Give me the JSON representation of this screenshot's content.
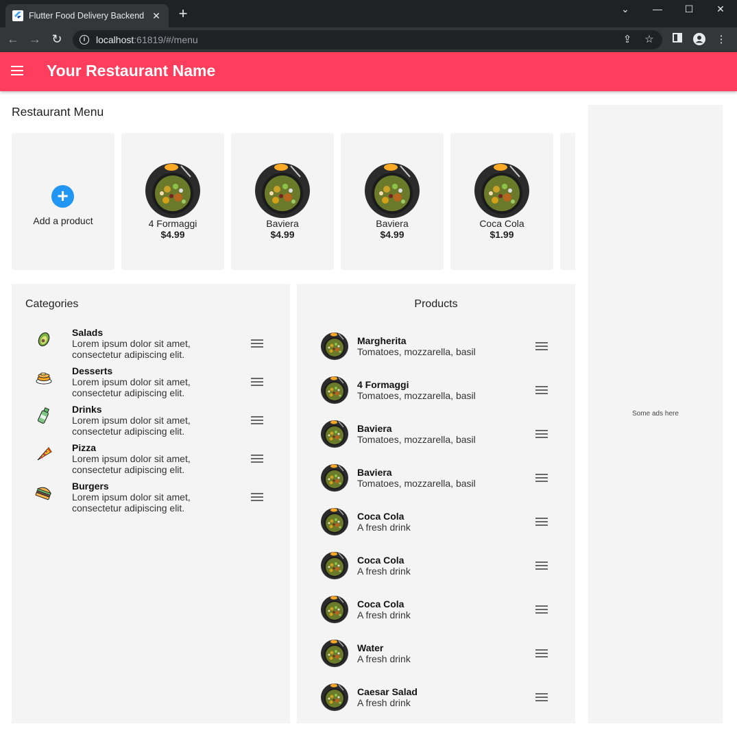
{
  "browser": {
    "tab_title": "Flutter Food Delivery Backend",
    "url_host": "localhost",
    "url_rest": ":61819/#/menu"
  },
  "appbar": {
    "title": "Your Restaurant Name"
  },
  "menu": {
    "title": "Restaurant Menu",
    "add_label": "Add a product",
    "cards": [
      {
        "name": "4 Formaggi",
        "price": "$4.99"
      },
      {
        "name": "Baviera",
        "price": "$4.99"
      },
      {
        "name": "Baviera",
        "price": "$4.99"
      },
      {
        "name": "Coca Cola",
        "price": "$1.99"
      }
    ]
  },
  "categories": {
    "title": "Categories",
    "items": [
      {
        "name": "Salads",
        "desc": "Lorem ipsum dolor sit amet, consectetur adipiscing elit.",
        "icon": "avocado-icon"
      },
      {
        "name": "Desserts",
        "desc": "Lorem ipsum dolor sit amet, consectetur adipiscing elit.",
        "icon": "pancakes-icon"
      },
      {
        "name": "Drinks",
        "desc": "Lorem ipsum dolor sit amet, consectetur adipiscing elit.",
        "icon": "bottle-icon"
      },
      {
        "name": "Pizza",
        "desc": "Lorem ipsum dolor sit amet, consectetur adipiscing elit.",
        "icon": "pizza-icon"
      },
      {
        "name": "Burgers",
        "desc": "Lorem ipsum dolor sit amet, consectetur adipiscing elit.",
        "icon": "burger-icon"
      }
    ]
  },
  "products": {
    "title": "Products",
    "items": [
      {
        "name": "Margherita",
        "desc": "Tomatoes, mozzarella, basil"
      },
      {
        "name": "4 Formaggi",
        "desc": "Tomatoes, mozzarella, basil"
      },
      {
        "name": "Baviera",
        "desc": "Tomatoes, mozzarella, basil"
      },
      {
        "name": "Baviera",
        "desc": "Tomatoes, mozzarella, basil"
      },
      {
        "name": "Coca Cola",
        "desc": "A fresh drink"
      },
      {
        "name": "Coca Cola",
        "desc": "A fresh drink"
      },
      {
        "name": "Coca Cola",
        "desc": "A fresh drink"
      },
      {
        "name": "Water",
        "desc": "A fresh drink"
      },
      {
        "name": "Caesar Salad",
        "desc": "A fresh drink"
      }
    ]
  },
  "ads": {
    "text": "Some ads here"
  },
  "colors": {
    "appbar": "#ff3d5c",
    "accent": "#2196f3",
    "panel": "#f4f4f4"
  }
}
